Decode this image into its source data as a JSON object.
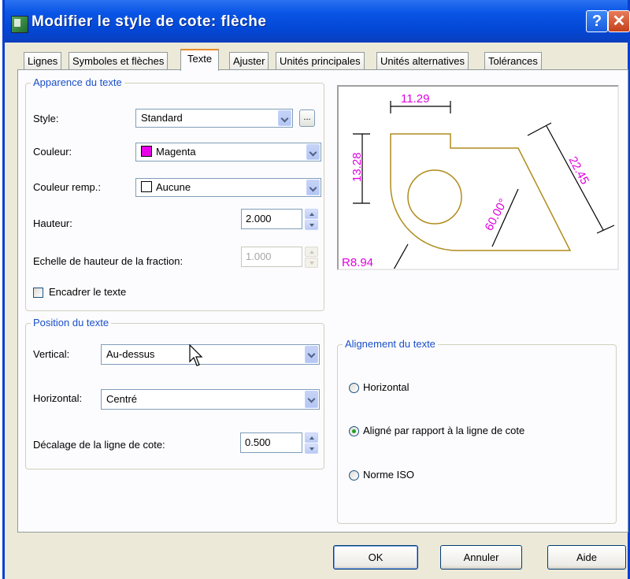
{
  "window": {
    "title": "Modifier le style de cote: flèche",
    "help_glyph": "?",
    "close_glyph": "✕"
  },
  "tabs": [
    {
      "label": "Lignes"
    },
    {
      "label": "Symboles et flèches"
    },
    {
      "label": "Texte",
      "active": true
    },
    {
      "label": "Ajuster"
    },
    {
      "label": "Unités principales"
    },
    {
      "label": "Unités alternatives"
    },
    {
      "label": "Tolérances"
    }
  ],
  "appearance": {
    "legend": "Apparence du texte",
    "style_label": "Style:",
    "style_value": "Standard",
    "ellipsis": "...",
    "color_label": "Couleur:",
    "color_value": "Magenta",
    "color_swatch": "#e800e8",
    "fill_label": "Couleur remp.:",
    "fill_value": "Aucune",
    "fill_swatch": "#ffffff",
    "height_label": "Hauteur:",
    "height_value": "2.000",
    "fraction_label": "Echelle de hauteur de la fraction:",
    "fraction_value": "1.000",
    "frame_label": "Encadrer le texte",
    "frame_checked": false
  },
  "position": {
    "legend": "Position du texte",
    "vertical_label": "Vertical:",
    "vertical_value": "Au-dessus",
    "horizontal_label": "Horizontal:",
    "horizontal_value": "Centré",
    "offset_label": "Décalage de la ligne de cote:",
    "offset_value": "0.500"
  },
  "alignment": {
    "legend": "Alignement du texte",
    "options": [
      {
        "label": "Horizontal",
        "checked": false
      },
      {
        "label": "Aligné par rapport à la ligne de cote",
        "checked": true
      },
      {
        "label": "Norme ISO",
        "checked": false
      }
    ]
  },
  "preview": {
    "dims": {
      "width": "11.29",
      "height": "13.28",
      "diagonal": "22.45",
      "angle": "60.00°",
      "radius": "R8.94"
    },
    "colors": {
      "outline": "#b08c1c",
      "dimtext": "#e000e0",
      "lines": "#000000"
    }
  },
  "buttons": {
    "ok": "OK",
    "cancel": "Annuler",
    "help": "Aide"
  }
}
